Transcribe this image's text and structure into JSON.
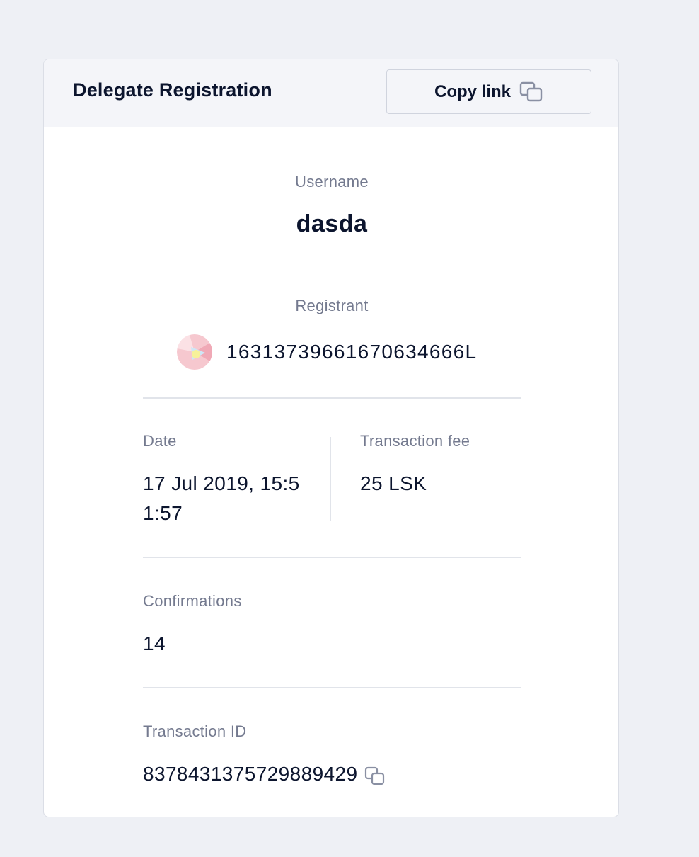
{
  "header": {
    "title": "Delegate Registration",
    "copy_link_label": "Copy link"
  },
  "username": {
    "label": "Username",
    "value": "dasda"
  },
  "registrant": {
    "label": "Registrant",
    "address": "16313739661670634666L",
    "avatar_icon": "account-avatar-icon"
  },
  "date": {
    "label": "Date",
    "value_line1": "17 Jul 2019, 15:5",
    "value_line2": "1:57"
  },
  "fee": {
    "label": "Transaction fee",
    "value": "25 LSK"
  },
  "confirmations": {
    "label": "Confirmations",
    "value": "14"
  },
  "transaction_id": {
    "label": "Transaction ID",
    "value": "8378431375729889429"
  },
  "colors": {
    "background": "#eef0f5",
    "card": "#ffffff",
    "header": "#f4f5f9",
    "text": "#0c152e",
    "muted": "#747a8f",
    "divider": "#e1e4ea"
  }
}
